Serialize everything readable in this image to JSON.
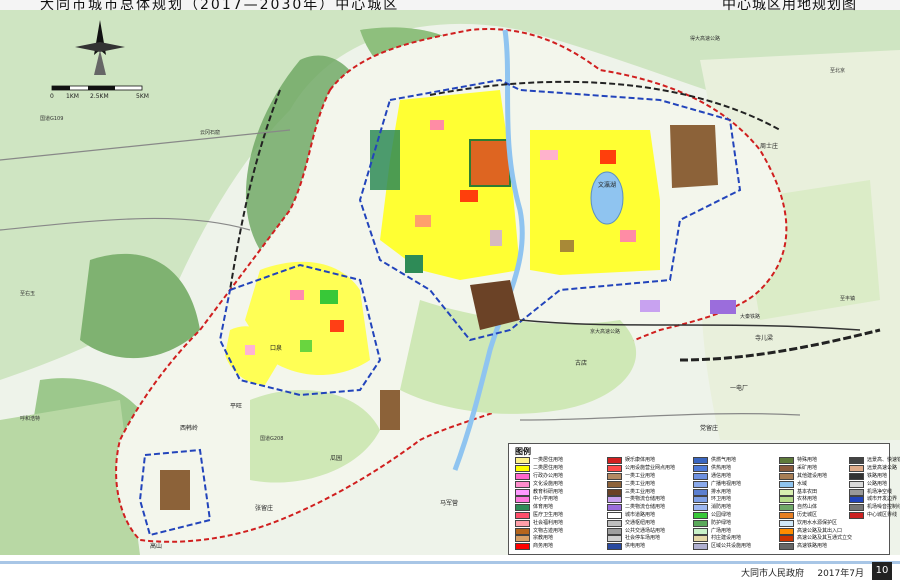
{
  "header": {
    "title_left": "大同市城市总体规划（2017—2030年）中心城区",
    "title_right": "中心城区用地规划图"
  },
  "scale_bar": {
    "labels": [
      "0",
      "1KM",
      "2.5KM",
      "5KM"
    ]
  },
  "map_labels": {
    "lake": "文瀛湖",
    "roads": [
      "至北京",
      "至丰镇",
      "京大高速公路",
      "大秦铁路",
      "至右玉",
      "呼和浩特",
      "国道G109",
      "国道G208",
      "云冈石窟",
      "得大高速公路"
    ],
    "places": [
      "口泉",
      "马军营",
      "西韩岭",
      "平旺",
      "古店",
      "周士庄",
      "党留庄",
      "高山",
      "张留庄",
      "瓜园",
      "一电厂",
      "寺儿梁"
    ]
  },
  "legend": {
    "title": "图例",
    "columns": [
      [
        {
          "label": "一类居住用地",
          "color": "#fff38a"
        },
        {
          "label": "二类居住用地",
          "color": "#ffff00"
        },
        {
          "label": "行政办公用地",
          "color": "#ff66cc"
        },
        {
          "label": "文化设施用地",
          "color": "#ff8ccc"
        },
        {
          "label": "教育科研用地",
          "color": "#ff99ff"
        },
        {
          "label": "中小学用地",
          "color": "#ff77dd"
        },
        {
          "label": "体育用地",
          "color": "#2e8b57"
        },
        {
          "label": "医疗卫生用地",
          "color": "#ff4d6a"
        },
        {
          "label": "社会福利用地",
          "color": "#ff9fa9"
        },
        {
          "label": "文物古迹用地",
          "color": "#b5651d"
        },
        {
          "label": "宗教用地",
          "color": "#d9a066"
        },
        {
          "label": "商务用地",
          "color": "#ff0000"
        }
      ],
      [
        {
          "label": "娱乐康体用地",
          "color": "#d22020"
        },
        {
          "label": "公用设施营业网点用地",
          "color": "#ff4a4a"
        },
        {
          "label": "一类工业用地",
          "color": "#b38a63"
        },
        {
          "label": "二类工业用地",
          "color": "#8c6239"
        },
        {
          "label": "三类工业用地",
          "color": "#6b4226"
        },
        {
          "label": "一类物流仓储用地",
          "color": "#c8a2f0"
        },
        {
          "label": "二类物流仓储用地",
          "color": "#9b6ddc"
        },
        {
          "label": "城市道路用地",
          "color": "#ffffff"
        },
        {
          "label": "交通枢纽用地",
          "color": "#bfbfbf"
        },
        {
          "label": "公共交通场站用地",
          "color": "#9e9e9e"
        },
        {
          "label": "社会停车场用地",
          "color": "#cfcfcf"
        },
        {
          "label": "供电用地",
          "color": "#2a4aa0"
        }
      ],
      [
        {
          "label": "供燃气用地",
          "color": "#3a66c0"
        },
        {
          "label": "供热用地",
          "color": "#4f7bd8"
        },
        {
          "label": "通信用地",
          "color": "#6e91e0"
        },
        {
          "label": "广播电视用地",
          "color": "#8aa9ea"
        },
        {
          "label": "排水用地",
          "color": "#5b7fd0"
        },
        {
          "label": "环卫用地",
          "color": "#7fa0e6"
        },
        {
          "label": "消防用地",
          "color": "#9db7f0"
        },
        {
          "label": "公园绿地",
          "color": "#38c838"
        },
        {
          "label": "防护绿地",
          "color": "#5aa95a"
        },
        {
          "label": "广场用地",
          "color": "#c9f2c9"
        },
        {
          "label": "村庄建设用地",
          "color": "#e5d9a8"
        },
        {
          "label": "区域公共设施用地",
          "color": "#b0b0d0"
        }
      ],
      [
        {
          "label": "特殊用地",
          "color": "#5e7a3a"
        },
        {
          "label": "采矿用地",
          "color": "#8a5a3c"
        },
        {
          "label": "其他建设用地",
          "color": "#a87e55"
        },
        {
          "label": "水域",
          "color": "#8fc4f0"
        },
        {
          "label": "基本农田",
          "color": "#d8efb0"
        },
        {
          "label": "农林用地",
          "color": "#b5dc8a"
        },
        {
          "label": "自然山体",
          "color": "#6fa868"
        },
        {
          "label": "历史城区",
          "color": "#e67e22"
        },
        {
          "label": "饮用水水源保护区",
          "color": "#d0e8f8"
        },
        {
          "label": "高速公路及其出入口",
          "color": "#ff8c00"
        },
        {
          "label": "高速公路及其互通式立交",
          "color": "#cc3300"
        },
        {
          "label": "高速铁路用地",
          "color": "#666666"
        }
      ],
      [
        {
          "label": "远景高、快速铁路",
          "color": "#444444"
        },
        {
          "label": "远景高速公路",
          "color": "#e0ac8a"
        },
        {
          "label": "铁路用地",
          "color": "#333333"
        },
        {
          "label": "公路用地",
          "color": "#d9d9d9"
        },
        {
          "label": "机场净空线",
          "color": "#999999"
        },
        {
          "label": "城市开发边界",
          "color": "#2244bb"
        },
        {
          "label": "机场噪音控制线",
          "color": "#777777"
        },
        {
          "label": "中心城区界线",
          "color": "#cc2222"
        }
      ]
    ]
  },
  "footer": {
    "organization": "大同市人民政府",
    "date": "2017年7月",
    "page_number": "10"
  }
}
